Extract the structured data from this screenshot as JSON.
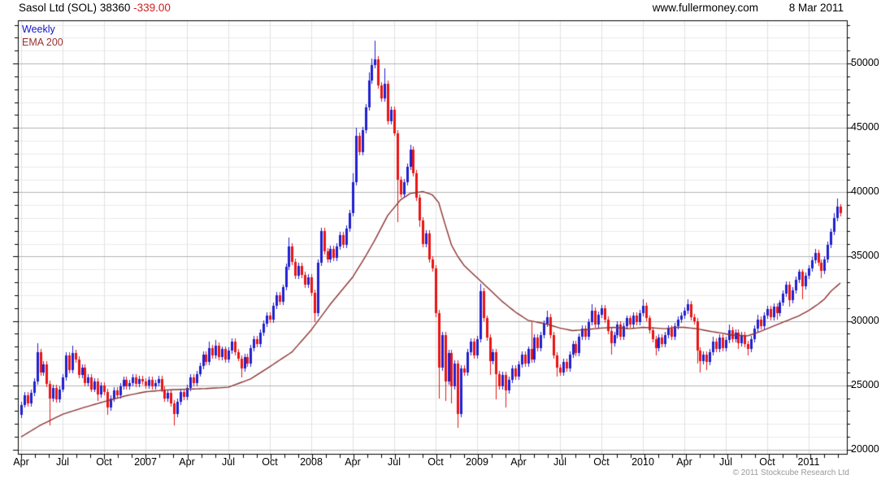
{
  "header": {
    "instrument": "Sasol Ltd (SOL)",
    "price": "38360",
    "change": "-339.00",
    "site": "www.fullermoney.com",
    "date": "8 Mar 2011"
  },
  "legend": {
    "weekly": "Weekly",
    "ema": "EMA 200"
  },
  "footer": {
    "copyright": "© 2011 Stockcube Research Ltd"
  },
  "colors": {
    "up_candle": "#2020cf",
    "down_candle": "#ea1414",
    "ema_line": "#8e3434",
    "change_text": "#cc2222",
    "grid_minor": "#ececec",
    "grid_major": "#b3b3b3",
    "grid_vertical": "#e2e2e2",
    "axis": "#000000",
    "copyright_text": "#999999"
  },
  "chart_data": {
    "type": "candlestick",
    "timeframe": "Weekly",
    "overlay": "EMA 200",
    "title": "Sasol Ltd (SOL) 38360 -339.00",
    "last_close": 38360,
    "change": -339.0,
    "ylim": [
      19680,
      53350
    ],
    "y_ticks": [
      20000,
      25000,
      30000,
      35000,
      40000,
      45000,
      50000
    ],
    "y_minor_step": 1000,
    "x_labels": [
      {
        "label": "Apr",
        "week": 0
      },
      {
        "label": "Jul",
        "week": 13
      },
      {
        "label": "Oct",
        "week": 26
      },
      {
        "label": "2007",
        "week": 39
      },
      {
        "label": "Apr",
        "week": 52
      },
      {
        "label": "Jul",
        "week": 65
      },
      {
        "label": "Oct",
        "week": 78
      },
      {
        "label": "2008",
        "week": 91
      },
      {
        "label": "Apr",
        "week": 104
      },
      {
        "label": "Jul",
        "week": 117
      },
      {
        "label": "Oct",
        "week": 130
      },
      {
        "label": "2009",
        "week": 143
      },
      {
        "label": "Apr",
        "week": 156
      },
      {
        "label": "Jul",
        "week": 169
      },
      {
        "label": "Oct",
        "week": 182
      },
      {
        "label": "2010",
        "week": 195
      },
      {
        "label": "Apr",
        "week": 208
      },
      {
        "label": "Jul",
        "week": 221
      },
      {
        "label": "Oct",
        "week": 234
      },
      {
        "label": "2011",
        "week": 247
      }
    ],
    "weeks_per_month": 4.345,
    "months_total": 60,
    "first_open": 22700,
    "default_wick": 250,
    "candles": [
      [
        23500
      ],
      [
        24200
      ],
      [
        23600
      ],
      [
        24400
      ],
      [
        25300
      ],
      [
        27600,
        28300,
        0
      ],
      [
        26000
      ],
      [
        26600
      ],
      [
        25100
      ],
      [
        24000,
        0,
        21900
      ],
      [
        24800
      ],
      [
        23900
      ],
      [
        24700
      ],
      [
        25600
      ],
      [
        27300
      ],
      [
        26200
      ],
      [
        27500,
        28100,
        0
      ],
      [
        27000
      ],
      [
        25800
      ],
      [
        26400
      ],
      [
        25200
      ],
      [
        25600
      ],
      [
        24700
      ],
      [
        25300
      ],
      [
        24300,
        0,
        23800
      ],
      [
        25000
      ],
      [
        24500
      ],
      [
        23300,
        0,
        22700
      ],
      [
        24000
      ],
      [
        24600
      ],
      [
        24200
      ],
      [
        24900
      ],
      [
        25400
      ],
      [
        24900
      ],
      [
        25200
      ],
      [
        25600
      ],
      [
        25100
      ],
      [
        25500
      ],
      [
        25300
      ],
      [
        25000
      ],
      [
        25400
      ],
      [
        24900
      ],
      [
        25200
      ],
      [
        25500
      ],
      [
        24700
      ],
      [
        24000
      ],
      [
        24400
      ],
      [
        23600
      ],
      [
        22800,
        0,
        21900
      ],
      [
        23700
      ],
      [
        24500
      ],
      [
        24100
      ],
      [
        24800
      ],
      [
        25600
      ],
      [
        25200
      ],
      [
        25900
      ],
      [
        26500
      ],
      [
        27400
      ],
      [
        26800
      ],
      [
        27900,
        28400,
        0
      ],
      [
        27300
      ],
      [
        28100,
        28500,
        0
      ],
      [
        27200
      ],
      [
        27800
      ],
      [
        27000
      ],
      [
        27700
      ],
      [
        28400
      ],
      [
        27600
      ],
      [
        27100
      ],
      [
        26300,
        0,
        25600
      ],
      [
        27200
      ],
      [
        26700
      ],
      [
        27900
      ],
      [
        28600
      ],
      [
        28200
      ],
      [
        29100
      ],
      [
        29800
      ],
      [
        30400
      ],
      [
        30100
      ],
      [
        31200
      ],
      [
        32000
      ],
      [
        31500
      ],
      [
        32600
      ],
      [
        34200
      ],
      [
        35800,
        36500,
        0
      ],
      [
        34600
      ],
      [
        33500
      ],
      [
        34300
      ],
      [
        33600
      ],
      [
        32800
      ],
      [
        33400
      ],
      [
        32200
      ],
      [
        30600,
        0,
        29900
      ],
      [
        34500
      ],
      [
        37000
      ],
      [
        35400
      ],
      [
        34800
      ],
      [
        35600
      ],
      [
        34900
      ],
      [
        35800
      ],
      [
        36700
      ],
      [
        35900
      ],
      [
        37200
      ],
      [
        38400
      ],
      [
        40800,
        41500,
        0
      ],
      [
        44400,
        45000,
        0
      ],
      [
        43100
      ],
      [
        44800
      ],
      [
        46600
      ],
      [
        48700,
        49300,
        0
      ],
      [
        49900,
        50400,
        0
      ],
      [
        50300,
        51800,
        0
      ],
      [
        48300
      ],
      [
        47300
      ],
      [
        48400,
        49600,
        0
      ],
      [
        45500
      ],
      [
        46400
      ],
      [
        44600
      ],
      [
        41000,
        0,
        37700
      ],
      [
        39800
      ],
      [
        40800
      ],
      [
        42000
      ],
      [
        43300,
        43700,
        0
      ],
      [
        41500
      ],
      [
        39600
      ],
      [
        37800,
        0,
        37300
      ],
      [
        36000
      ],
      [
        36800
      ],
      [
        34800
      ],
      [
        34100
      ],
      [
        30600,
        0,
        30300
      ],
      [
        26400,
        0,
        24000
      ],
      [
        28900
      ],
      [
        25300,
        0,
        23800
      ],
      [
        27500
      ],
      [
        24900,
        0,
        23600
      ],
      [
        26700
      ],
      [
        22800,
        0,
        21700
      ],
      [
        26300
      ],
      [
        26000
      ],
      [
        27600
      ],
      [
        28400
      ],
      [
        27300
      ],
      [
        28600
      ],
      [
        32300,
        32900,
        0
      ],
      [
        30200
      ],
      [
        28700
      ],
      [
        26900,
        0,
        25800
      ],
      [
        27600
      ],
      [
        25900,
        0,
        23900
      ],
      [
        24900
      ],
      [
        25800
      ],
      [
        24600,
        0,
        23300
      ],
      [
        25400
      ],
      [
        26300
      ],
      [
        25700
      ],
      [
        26600
      ],
      [
        27400
      ],
      [
        26700
      ],
      [
        27800
      ],
      [
        27000,
        29900,
        0
      ],
      [
        28700
      ],
      [
        27900
      ],
      [
        28900
      ],
      [
        29800
      ],
      [
        30300,
        30800,
        0
      ],
      [
        28900
      ],
      [
        27300
      ],
      [
        26400,
        0,
        25700
      ],
      [
        26000
      ],
      [
        26800
      ],
      [
        26300
      ],
      [
        27400
      ],
      [
        28200
      ],
      [
        27500
      ],
      [
        28800
      ],
      [
        29400
      ],
      [
        28800
      ],
      [
        29900
      ],
      [
        30800,
        31300,
        0
      ],
      [
        29700
      ],
      [
        30500
      ],
      [
        31000
      ],
      [
        30100
      ],
      [
        29200
      ],
      [
        28300,
        0,
        27400
      ],
      [
        28900
      ],
      [
        29700
      ],
      [
        28800
      ],
      [
        29600
      ],
      [
        30200
      ],
      [
        29700
      ],
      [
        30400
      ],
      [
        29900
      ],
      [
        30600
      ],
      [
        31200,
        31700,
        0
      ],
      [
        30200
      ],
      [
        29300
      ],
      [
        28600
      ],
      [
        27900,
        0,
        27300
      ],
      [
        28700
      ],
      [
        28200
      ],
      [
        28900
      ],
      [
        29400
      ],
      [
        28800
      ],
      [
        29600
      ],
      [
        30100
      ],
      [
        30400
      ],
      [
        30800
      ],
      [
        31300,
        31700,
        0
      ],
      [
        30300
      ],
      [
        30000
      ],
      [
        27700,
        0,
        26700
      ],
      [
        26900,
        0,
        26000
      ],
      [
        27400
      ],
      [
        26800,
        0,
        26200
      ],
      [
        27600
      ],
      [
        28400,
        28800,
        0
      ],
      [
        27800
      ],
      [
        28700
      ],
      [
        27900
      ],
      [
        28500
      ],
      [
        29300,
        29700,
        0
      ],
      [
        28600
      ],
      [
        29100
      ],
      [
        28300,
        0,
        27800
      ],
      [
        28900
      ],
      [
        28200
      ],
      [
        27800,
        0,
        27300
      ],
      [
        28600
      ],
      [
        29400
      ],
      [
        30100,
        30500,
        0
      ],
      [
        29600
      ],
      [
        30400
      ],
      [
        30900
      ],
      [
        30300
      ],
      [
        31100
      ],
      [
        30600,
        0,
        30100
      ],
      [
        31400
      ],
      [
        32100
      ],
      [
        32800
      ],
      [
        31600,
        0,
        31100
      ],
      [
        32400
      ],
      [
        33200
      ],
      [
        33800
      ],
      [
        32700,
        0,
        31700
      ],
      [
        33500
      ],
      [
        34100
      ],
      [
        34700
      ],
      [
        35300,
        35600,
        0
      ],
      [
        34500
      ],
      [
        33900,
        0,
        33300
      ],
      [
        34800
      ],
      [
        35900
      ],
      [
        36900
      ],
      [
        38000,
        38400,
        0
      ],
      [
        38900,
        39500,
        0
      ],
      [
        38360,
        39100,
        0
      ]
    ],
    "ema_anchors": [
      [
        0,
        21000
      ],
      [
        6,
        21900
      ],
      [
        13,
        22750
      ],
      [
        20,
        23300
      ],
      [
        26,
        23730
      ],
      [
        33,
        24200
      ],
      [
        39,
        24500
      ],
      [
        46,
        24650
      ],
      [
        52,
        24700
      ],
      [
        58,
        24750
      ],
      [
        65,
        24850
      ],
      [
        72,
        25500
      ],
      [
        78,
        26450
      ],
      [
        85,
        27600
      ],
      [
        91,
        29300
      ],
      [
        97,
        31300
      ],
      [
        104,
        33400
      ],
      [
        108,
        35000
      ],
      [
        111,
        36300
      ],
      [
        115,
        38200
      ],
      [
        119,
        39400
      ],
      [
        122,
        39900
      ],
      [
        126,
        40050
      ],
      [
        129,
        39800
      ],
      [
        131,
        39200
      ],
      [
        133,
        37500
      ],
      [
        135,
        35900
      ],
      [
        137,
        35000
      ],
      [
        139,
        34300
      ],
      [
        142,
        33600
      ],
      [
        145,
        32900
      ],
      [
        148,
        32200
      ],
      [
        151,
        31500
      ],
      [
        155,
        30700
      ],
      [
        159,
        30050
      ],
      [
        165,
        29750
      ],
      [
        169,
        29450
      ],
      [
        173,
        29250
      ],
      [
        178,
        29350
      ],
      [
        182,
        29450
      ],
      [
        186,
        29500
      ],
      [
        191,
        29400
      ],
      [
        195,
        29500
      ],
      [
        199,
        29450
      ],
      [
        202,
        29400
      ],
      [
        205,
        29500
      ],
      [
        208,
        29500
      ],
      [
        212,
        29400
      ],
      [
        216,
        29200
      ],
      [
        220,
        29050
      ],
      [
        223,
        28900
      ],
      [
        228,
        28850
      ],
      [
        231,
        29100
      ],
      [
        234,
        29400
      ],
      [
        238,
        29800
      ],
      [
        241,
        30100
      ],
      [
        244,
        30400
      ],
      [
        247,
        30800
      ],
      [
        250,
        31300
      ],
      [
        252,
        31700
      ],
      [
        254,
        32300
      ],
      [
        257,
        32950
      ]
    ]
  }
}
